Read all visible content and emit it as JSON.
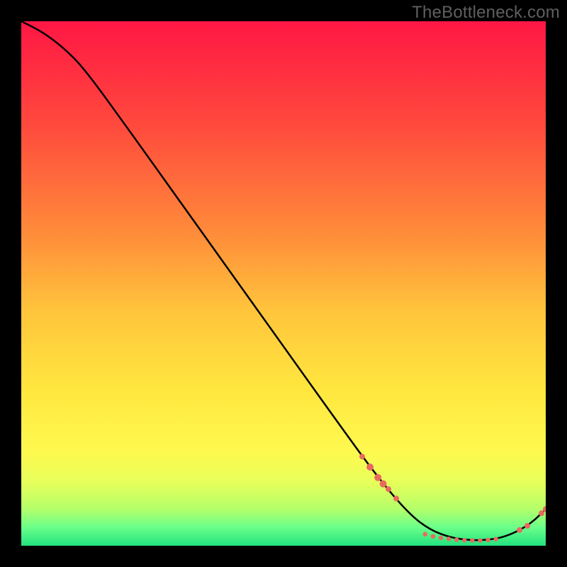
{
  "watermark": "TheBottleneck.com",
  "chart_data": {
    "type": "line",
    "title": "",
    "xlabel": "",
    "ylabel": "",
    "xlim": [
      0,
      100
    ],
    "ylim": [
      0,
      100
    ],
    "gradient_stops": [
      {
        "offset": 0.0,
        "color": "#ff1744"
      },
      {
        "offset": 0.2,
        "color": "#ff4a3d"
      },
      {
        "offset": 0.4,
        "color": "#ff8a3a"
      },
      {
        "offset": 0.55,
        "color": "#ffc43c"
      },
      {
        "offset": 0.7,
        "color": "#ffe63e"
      },
      {
        "offset": 0.82,
        "color": "#fff94f"
      },
      {
        "offset": 0.88,
        "color": "#e6ff5a"
      },
      {
        "offset": 0.93,
        "color": "#b4ff6a"
      },
      {
        "offset": 0.965,
        "color": "#6aff8a"
      },
      {
        "offset": 1.0,
        "color": "#22e27e"
      }
    ],
    "series": [
      {
        "name": "bottleneck-curve",
        "x": [
          0,
          4,
          8,
          12,
          20,
          30,
          40,
          50,
          60,
          68,
          74,
          78,
          82,
          86,
          90,
          93,
          96,
          98,
          100
        ],
        "y": [
          100,
          98,
          95,
          91,
          80,
          66,
          52,
          38,
          24,
          13,
          6,
          3,
          1.5,
          1,
          1.2,
          2,
          3.5,
          5,
          7
        ]
      }
    ],
    "highlight_points": {
      "name": "dots",
      "color": "#e86a5f",
      "points": [
        {
          "x": 65,
          "y": 17,
          "r": 4
        },
        {
          "x": 66.5,
          "y": 15,
          "r": 5
        },
        {
          "x": 68,
          "y": 13,
          "r": 5
        },
        {
          "x": 69,
          "y": 11.8,
          "r": 5
        },
        {
          "x": 70,
          "y": 10.8,
          "r": 4
        },
        {
          "x": 71.5,
          "y": 9,
          "r": 4
        },
        {
          "x": 77,
          "y": 2.2,
          "r": 3.2
        },
        {
          "x": 78.5,
          "y": 1.8,
          "r": 3.2
        },
        {
          "x": 80,
          "y": 1.5,
          "r": 3.2
        },
        {
          "x": 81.5,
          "y": 1.3,
          "r": 3.2
        },
        {
          "x": 83,
          "y": 1.15,
          "r": 3.2
        },
        {
          "x": 84.5,
          "y": 1.05,
          "r": 3.2
        },
        {
          "x": 86,
          "y": 1.0,
          "r": 3.2
        },
        {
          "x": 87.5,
          "y": 1.0,
          "r": 3.2
        },
        {
          "x": 89,
          "y": 1.1,
          "r": 3.2
        },
        {
          "x": 90.5,
          "y": 1.25,
          "r": 3.2
        },
        {
          "x": 95,
          "y": 3.0,
          "r": 4
        },
        {
          "x": 96.5,
          "y": 3.8,
          "r": 4
        },
        {
          "x": 99.2,
          "y": 6.2,
          "r": 4
        },
        {
          "x": 100,
          "y": 7.0,
          "r": 4
        }
      ]
    }
  }
}
